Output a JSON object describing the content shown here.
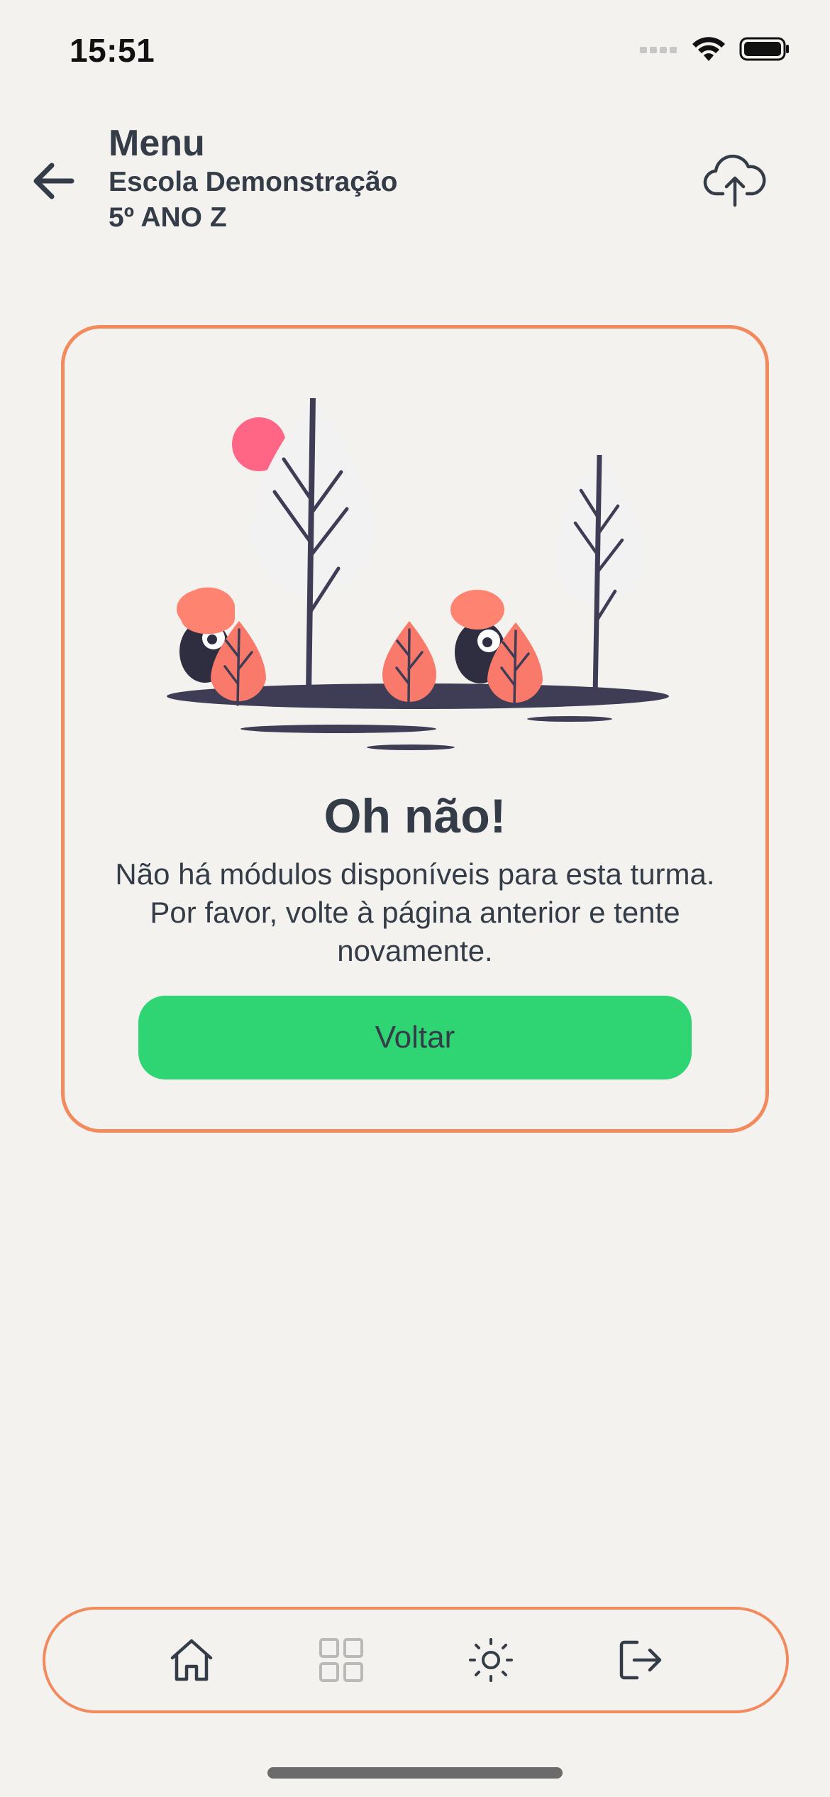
{
  "status_bar": {
    "time": "15:51"
  },
  "header": {
    "title": "Menu",
    "school": "Escola Demonstração",
    "class_name": "5º ANO Z",
    "back_icon": "arrow-left-icon",
    "upload_icon": "cloud-upload-icon"
  },
  "empty_state": {
    "title": "Oh não!",
    "message": "Não há módulos disponíveis para esta turma. Por favor, volte à página anterior e tente novamente.",
    "button_label": "Voltar"
  },
  "bottom_nav": {
    "items": [
      {
        "icon": "home-icon",
        "active": true
      },
      {
        "icon": "grid-icon",
        "active": false
      },
      {
        "icon": "sun-icon",
        "active": true
      },
      {
        "icon": "logout-icon",
        "active": true
      }
    ]
  },
  "colors": {
    "background": "#f4f2ef",
    "accent": "#f28a5d",
    "primary_button": "#2fd473",
    "text": "#343c47"
  }
}
